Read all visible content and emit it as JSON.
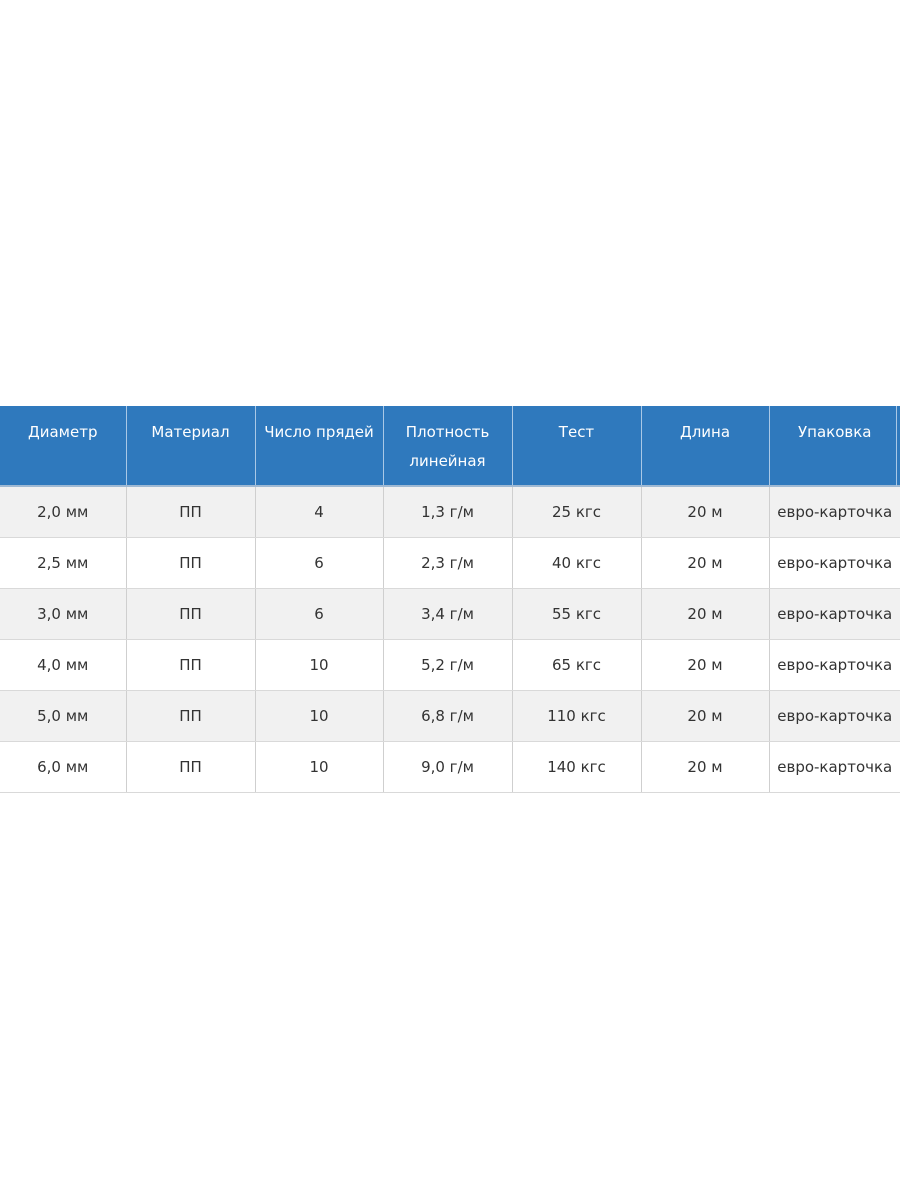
{
  "table": {
    "headers": [
      [
        "Диаметр"
      ],
      [
        "Материал"
      ],
      [
        "Число прядей"
      ],
      [
        "Плотность",
        "линейная"
      ],
      [
        "Тест"
      ],
      [
        "Длина"
      ],
      [
        "Упаковка"
      ]
    ],
    "rows": [
      [
        "2,0 мм",
        "ПП",
        "4",
        "1,3 г/м",
        "25 кгс",
        "20 м",
        "евро-карточка"
      ],
      [
        "2,5 мм",
        "ПП",
        "6",
        "2,3 г/м",
        "40 кгс",
        "20 м",
        "евро-карточка"
      ],
      [
        "3,0 мм",
        "ПП",
        "6",
        "3,4 г/м",
        "55 кгс",
        "20 м",
        "евро-карточка"
      ],
      [
        "4,0 мм",
        "ПП",
        "10",
        "5,2 г/м",
        "65 кгс",
        "20 м",
        "евро-карточка"
      ],
      [
        "5,0 мм",
        "ПП",
        "10",
        "6,8 г/м",
        "110 кгс",
        "20 м",
        "евро-карточка"
      ],
      [
        "6,0 мм",
        "ПП",
        "10",
        "9,0 г/м",
        "140 кгс",
        "20 м",
        "евро-карточка"
      ]
    ]
  },
  "colors": {
    "header_bg": "#2f79bd",
    "header_text": "#ffffff",
    "row_odd_bg": "#f1f1f1",
    "row_even_bg": "#ffffff",
    "cell_text": "#333333"
  }
}
